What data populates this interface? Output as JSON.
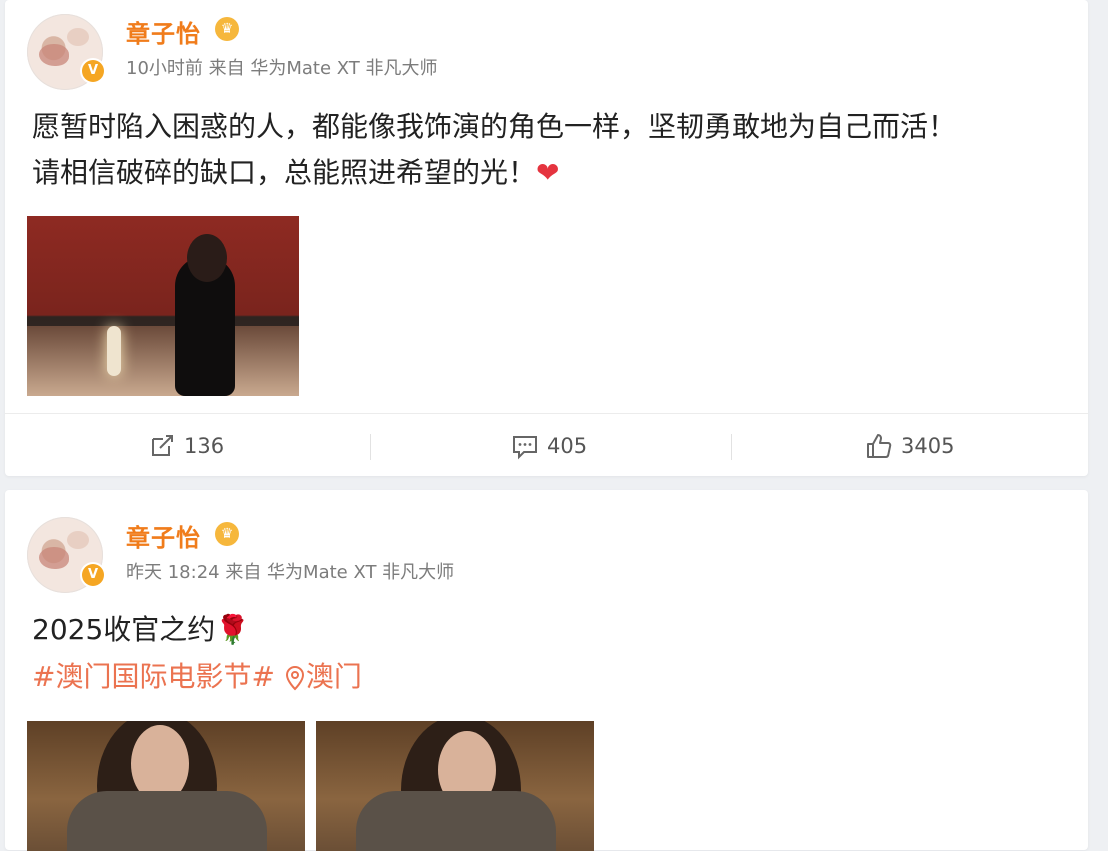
{
  "posts": [
    {
      "username": "章子怡",
      "meta": "10小时前 来自 华为Mate XT 非凡大师",
      "text_line1": "愿暂时陷入困惑的人，都能像我饰演的角色一样，坚韧勇敢地为自己而活！",
      "text_line2": "请相信破碎的缺口，总能照进希望的光！",
      "emoji": "❤",
      "actions": {
        "repost": "136",
        "comment": "405",
        "like": "3405"
      }
    },
    {
      "username": "章子怡",
      "meta": "昨天 18:24 来自 华为Mate XT 非凡大师",
      "text_line1": "2025收官之约",
      "emoji": "🌹",
      "hashtag": "#澳门国际电影节#",
      "location": "澳门"
    }
  ],
  "icons": {
    "verified": "v-badge-icon",
    "crown": "crown-icon",
    "repost": "repost-icon",
    "comment": "comment-icon",
    "like": "thumbs-up-icon",
    "location": "location-pin-icon"
  },
  "colors": {
    "username": "#f07c1b",
    "hashtag": "#eb7350",
    "meta": "#7c7c7c",
    "background": "#eef0f3"
  }
}
